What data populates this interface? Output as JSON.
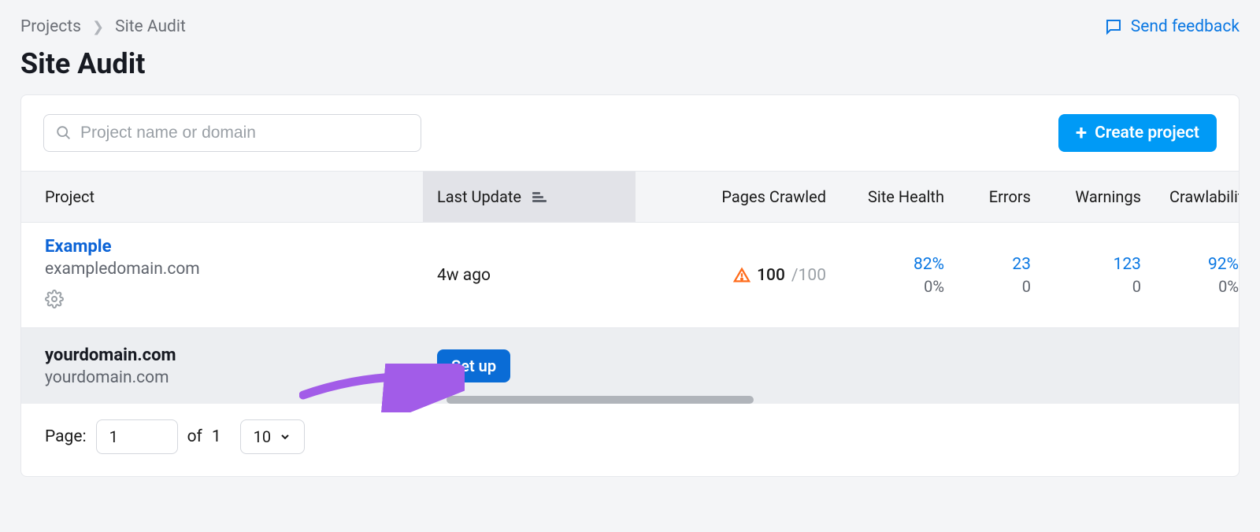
{
  "breadcrumb": {
    "root": "Projects",
    "current": "Site Audit"
  },
  "feedback_label": "Send feedback",
  "page_title": "Site Audit",
  "search": {
    "placeholder": "Project name or domain"
  },
  "create_button": "Create project",
  "columns": {
    "project": "Project",
    "last_update": "Last Update",
    "pages_crawled": "Pages Crawled",
    "site_health": "Site Health",
    "errors": "Errors",
    "warnings": "Warnings",
    "crawlability": "Crawlabilit"
  },
  "rows": [
    {
      "name": "Example",
      "domain": "exampledomain.com",
      "last_update": "4w ago",
      "pages_crawled": {
        "value": "100",
        "total": "/100"
      },
      "site_health": {
        "top": "82%",
        "bottom": "0%"
      },
      "errors": {
        "top": "23",
        "bottom": "0"
      },
      "warnings": {
        "top": "123",
        "bottom": "0"
      },
      "crawlability": {
        "top": "92%",
        "bottom": "0%"
      }
    },
    {
      "name": "yourdomain.com",
      "domain": "yourdomain.com",
      "setup_label": "Set up"
    }
  ],
  "pagination": {
    "label": "Page:",
    "current": "1",
    "of_label": "of",
    "total": "1",
    "page_size": "10"
  }
}
